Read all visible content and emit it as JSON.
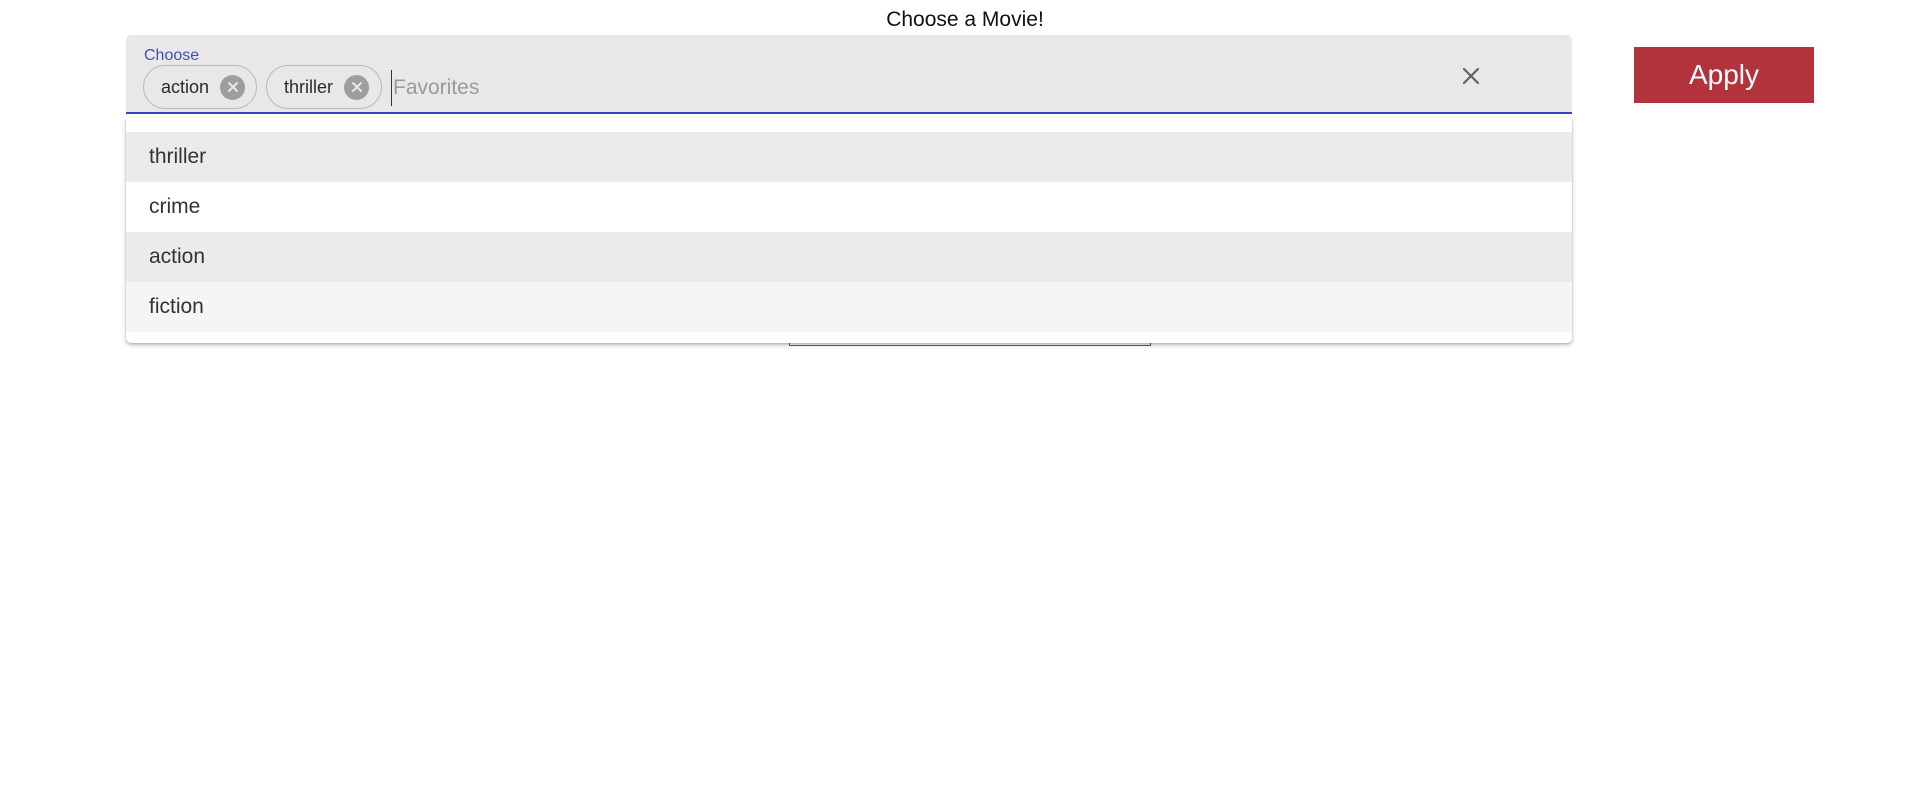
{
  "page": {
    "title": "Choose a Movie!"
  },
  "autocomplete": {
    "label": "Choose",
    "placeholder": "Favorites",
    "value": "",
    "chips": [
      {
        "label": "action"
      },
      {
        "label": "thriller"
      }
    ],
    "clear_icon": "close-icon",
    "chip_delete_icon": "cancel-circle-icon",
    "accent_color": "#3346c8"
  },
  "actions": {
    "apply_label": "Apply",
    "apply_color": "#b3333d"
  },
  "dropdown": {
    "options": [
      {
        "label": "thriller",
        "state": "selected"
      },
      {
        "label": "crime",
        "state": "normal"
      },
      {
        "label": "action",
        "state": "selected"
      },
      {
        "label": "fiction",
        "state": "hover"
      }
    ]
  }
}
